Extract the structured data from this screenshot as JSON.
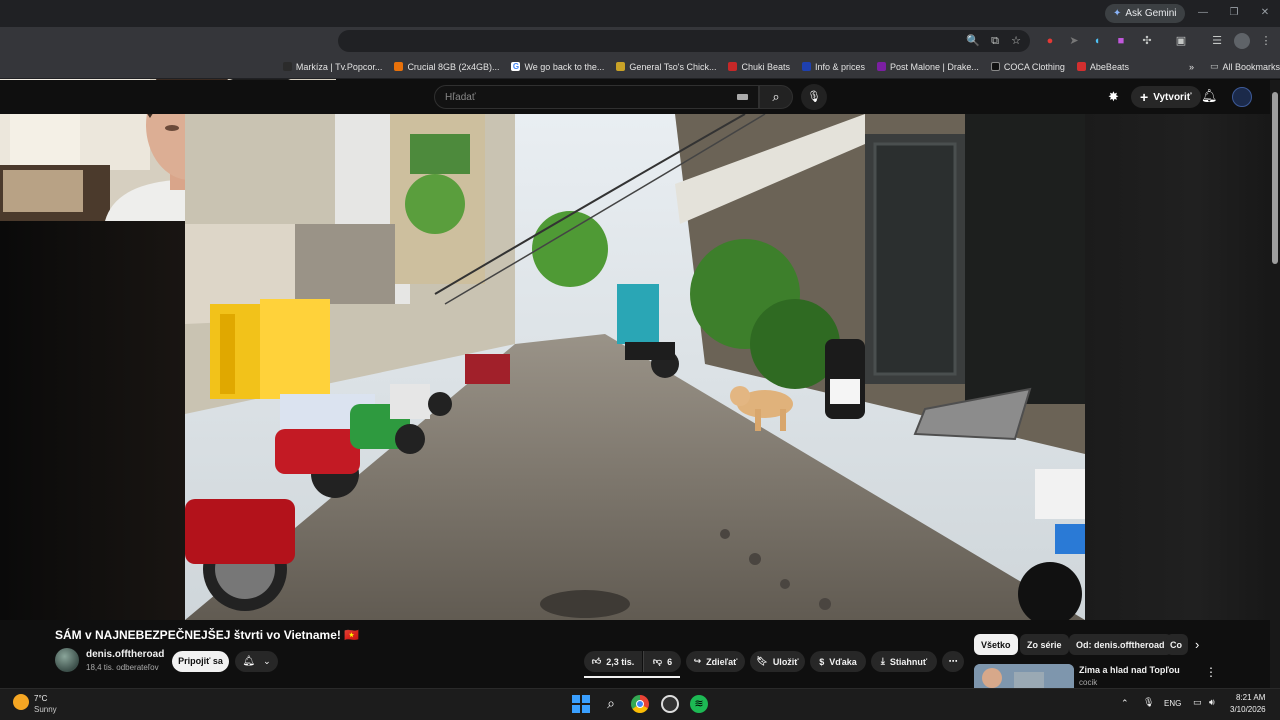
{
  "browser": {
    "ask_gemini": "Ask Gemini",
    "bookmarks": [
      {
        "label": "Markíza | Tv.Popcor...",
        "color": "#2b2b2b"
      },
      {
        "label": "Crucial 8GB (2x4GB)...",
        "color": "#e8710a"
      },
      {
        "label": "We go back to the...",
        "color": "#4285f4"
      },
      {
        "label": "General Tso's Chick...",
        "color": "#c9a227"
      },
      {
        "label": "Chuki Beats",
        "color": "#c62828"
      },
      {
        "label": "Info & prices",
        "color": "#1e40af"
      },
      {
        "label": "Post Malone | Drake...",
        "color": "#7b1fa2"
      },
      {
        "label": "COCA Clothing",
        "color": "#111111"
      },
      {
        "label": "AbeBeats",
        "color": "#d32f2f"
      }
    ],
    "all_bookmarks": "All Bookmarks"
  },
  "youtube": {
    "search_placeholder": "Hľadať",
    "create_label": "Vytvoriť",
    "video_title": "SÁM v NAJNEBEZPEČNEJŠEJ štvrti vo Vietname! 🇻🇳",
    "channel_name": "denis.offtheroad",
    "channel_subs": "18,4 tis. odberateľov",
    "join_label": "Pripojiť sa",
    "likes": "2,3 tis.",
    "dislikes": "6",
    "share_label": "Zdieľať",
    "save_label": "Uložiť",
    "thanks_label": "Vďaka",
    "download_label": "Stiahnuť",
    "chips": [
      "Všetko",
      "Zo série",
      "Od: denis.offtheroad",
      "Co"
    ],
    "recommended": {
      "title": "Zima a hlad nad Topľou",
      "channel": "cocik"
    },
    "colors": {
      "bg": "#0f0f0f",
      "pill": "#272727",
      "accent": "#ff0000"
    }
  },
  "taskbar": {
    "weather_temp": "7°C",
    "weather_desc": "Sunny",
    "lang": "ENG",
    "time": "8:21 AM",
    "date": "3/10/2026"
  }
}
